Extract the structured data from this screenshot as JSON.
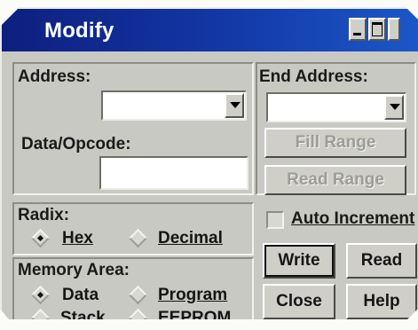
{
  "window": {
    "title": "Modify"
  },
  "address": {
    "label": "Address:",
    "value": ""
  },
  "data_opcode": {
    "label": "Data/Opcode:",
    "value": ""
  },
  "end_address": {
    "label": "End Address:",
    "value": ""
  },
  "buttons": {
    "fill_range": "Fill Range",
    "read_range": "Read Range",
    "write": "Write",
    "read": "Read",
    "close": "Close",
    "help": "Help"
  },
  "radix": {
    "label": "Radix:",
    "options": [
      "Hex",
      "Decimal"
    ],
    "selected": "Hex"
  },
  "auto_increment": {
    "label": "Auto Increment",
    "checked": false
  },
  "memory_area": {
    "label": "Memory Area:",
    "options": [
      "Data",
      "Program",
      "Stack",
      "EEPROM"
    ],
    "selected": "Data"
  },
  "colors": {
    "titlebar_start": "#0e1f7e",
    "titlebar_end": "#1b57c8",
    "face": "#c9c9c3"
  }
}
